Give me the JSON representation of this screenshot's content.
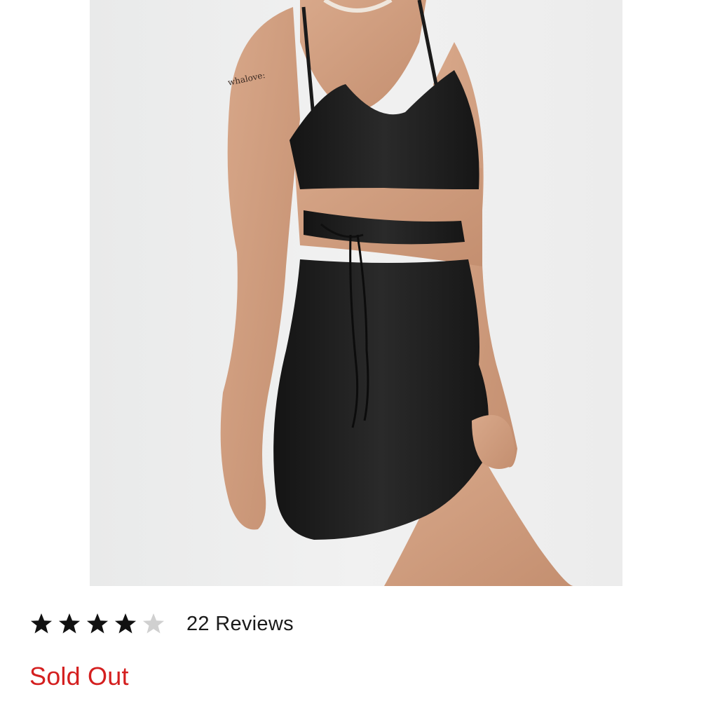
{
  "product": {
    "image_alt": "Model wearing black cut-out tie mini dress",
    "rating": {
      "value": 4,
      "max": 5,
      "filled_color": "#111111",
      "empty_color": "#d0d0d0",
      "star_icons": [
        "star-filled-icon",
        "star-filled-icon",
        "star-filled-icon",
        "star-filled-icon",
        "star-empty-icon"
      ]
    },
    "reviews_label": "22 Reviews",
    "status_label": "Sold Out",
    "status_color": "#d41f1f"
  }
}
